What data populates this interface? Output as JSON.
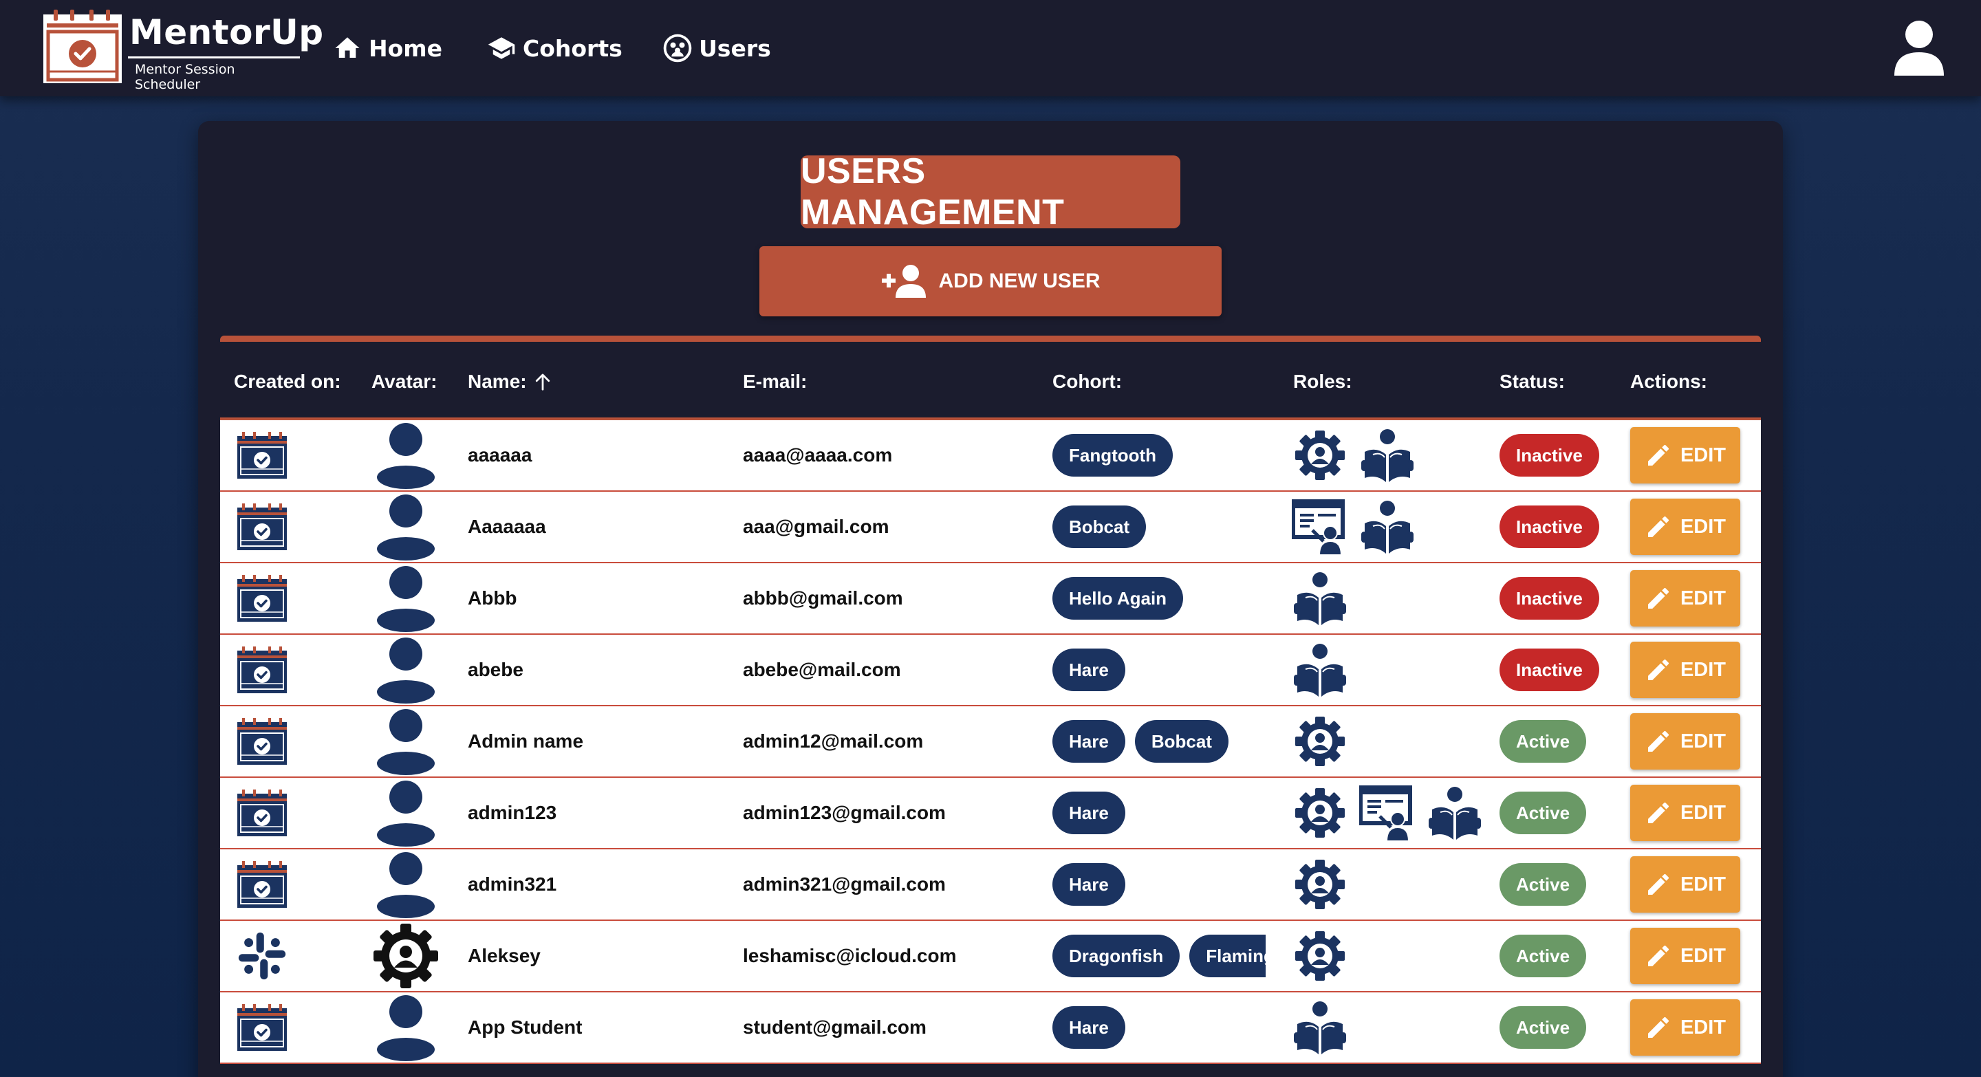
{
  "brand": {
    "title": "MentorUp",
    "subtitle": "Mentor Session Scheduler",
    "accent": "#b8523a"
  },
  "nav": {
    "items": [
      {
        "label": "Home",
        "icon": "home-icon"
      },
      {
        "label": "Cohorts",
        "icon": "graduation-cap-icon"
      },
      {
        "label": "Users",
        "icon": "users-icon"
      }
    ],
    "profile_icon": "user-profile-icon"
  },
  "page": {
    "title": "USERS MANAGEMENT",
    "add_button_label": "ADD NEW USER"
  },
  "table": {
    "headers": {
      "created": "Created on:",
      "avatar": "Avatar:",
      "name": "Name:",
      "email": "E-mail:",
      "cohort": "Cohort:",
      "roles": "Roles:",
      "status": "Status:",
      "actions": "Actions:"
    },
    "sort": {
      "column": "name",
      "direction": "ascending",
      "icon": "arrow-up-icon"
    },
    "edit_label": "EDIT",
    "rows": [
      {
        "created_icon": "calendar-check-icon",
        "avatar_icon": "user-silhouette-icon",
        "name": "aaaaaa",
        "email": "aaaa@aaaa.com",
        "cohorts": [
          "Fangtooth"
        ],
        "roles": [
          "admin",
          "student"
        ],
        "status": "Inactive"
      },
      {
        "created_icon": "calendar-check-icon",
        "avatar_icon": "user-silhouette-icon",
        "name": "Aaaaaaa",
        "email": "aaa@gmail.com",
        "cohorts": [
          "Bobcat"
        ],
        "roles": [
          "mentor",
          "student"
        ],
        "status": "Inactive"
      },
      {
        "created_icon": "calendar-check-icon",
        "avatar_icon": "user-silhouette-icon",
        "name": "Abbb",
        "email": "abbb@gmail.com",
        "cohorts": [
          "Hello Again"
        ],
        "roles": [
          "student"
        ],
        "status": "Inactive"
      },
      {
        "created_icon": "calendar-check-icon",
        "avatar_icon": "user-silhouette-icon",
        "name": "abebe",
        "email": "abebe@mail.com",
        "cohorts": [
          "Hare"
        ],
        "roles": [
          "student"
        ],
        "status": "Inactive"
      },
      {
        "created_icon": "calendar-check-icon",
        "avatar_icon": "user-silhouette-icon",
        "name": "Admin name",
        "email": "admin12@mail.com",
        "cohorts": [
          "Hare",
          "Bobcat"
        ],
        "roles": [
          "admin"
        ],
        "status": "Active"
      },
      {
        "created_icon": "calendar-check-icon",
        "avatar_icon": "user-silhouette-icon",
        "name": "admin123",
        "email": "admin123@gmail.com",
        "cohorts": [
          "Hare"
        ],
        "roles": [
          "admin",
          "mentor",
          "student"
        ],
        "status": "Active"
      },
      {
        "created_icon": "calendar-check-icon",
        "avatar_icon": "user-silhouette-icon",
        "name": "admin321",
        "email": "admin321@gmail.com",
        "cohorts": [
          "Hare"
        ],
        "roles": [
          "admin"
        ],
        "status": "Active"
      },
      {
        "created_icon": "slack-icon",
        "avatar_icon": "gear-avatar-icon",
        "name": "Aleksey",
        "email": "leshamisc@icloud.com",
        "cohorts": [
          "Dragonfish",
          "Flaming"
        ],
        "roles": [
          "admin"
        ],
        "status": "Active"
      },
      {
        "created_icon": "calendar-check-icon",
        "avatar_icon": "user-silhouette-icon",
        "name": "App Student",
        "email": "student@gmail.com",
        "cohorts": [
          "Hare"
        ],
        "roles": [
          "student"
        ],
        "status": "Active"
      }
    ]
  },
  "colors": {
    "navy": "#1b3360",
    "inactive": "#c62828",
    "active": "#6a9966",
    "edit": "#eb9a36"
  }
}
